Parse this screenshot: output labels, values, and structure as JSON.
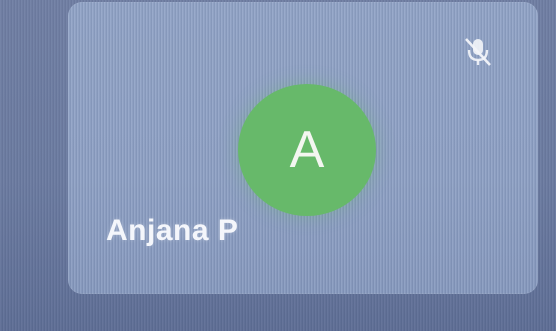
{
  "participant": {
    "name": "Anjana P",
    "avatar_initial": "A",
    "avatar_color": "#67b96a",
    "mic_status_icon": "mic-off-icon"
  },
  "colors": {
    "tile_background": "#8ea1c5",
    "page_background": "#6f7ea3"
  }
}
